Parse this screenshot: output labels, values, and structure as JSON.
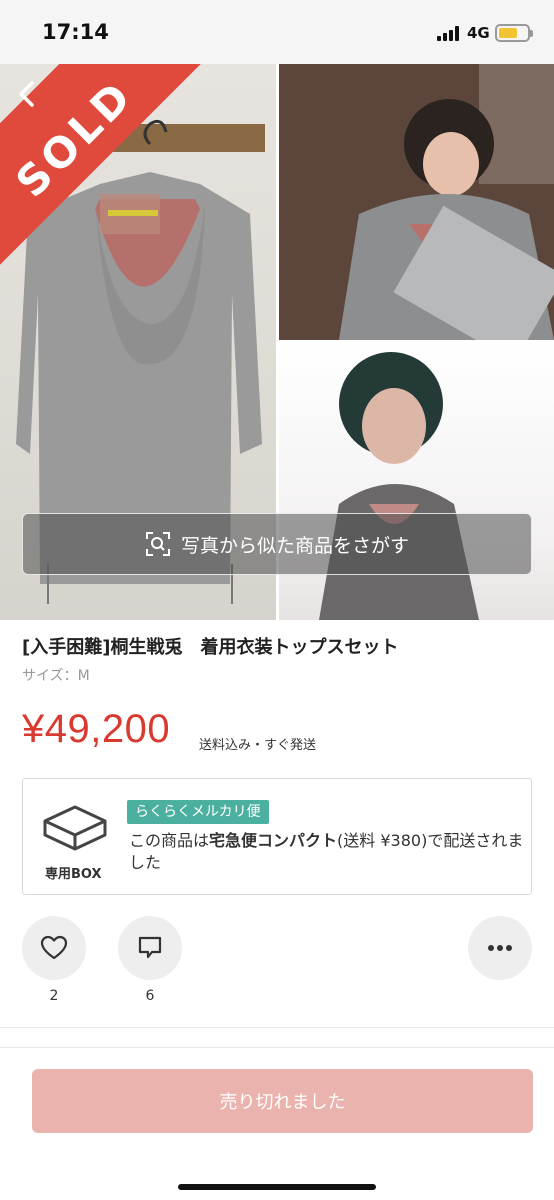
{
  "status_bar": {
    "time": "17:14",
    "network": "4G",
    "battery_color": "#f2c432"
  },
  "gallery": {
    "sold_label": "SOLD",
    "sold_color": "#e04a3c",
    "image_search_label": "写真から似た商品をさがす"
  },
  "product": {
    "title": "[入手困難]桐生戦兎　着用衣装トップスセット",
    "size": "サイズ：M",
    "price": "¥49,200",
    "price_color": "#d93a2f",
    "shipping_note": "送料込み・すぐ発送"
  },
  "shipping": {
    "box_label": "専用BOX",
    "service_badge": "らくらくメルカリ便",
    "badge_color": "#4cb0a0",
    "desc_prefix": "この商品は",
    "desc_bold": "宅急便コンパクト",
    "desc_suffix": "(送料 ¥380)で配送されました"
  },
  "actions": {
    "like_count": "2",
    "comment_count": "6"
  },
  "footer": {
    "sold_out_label": "売り切れました",
    "button_color": "#ebb3ad"
  }
}
